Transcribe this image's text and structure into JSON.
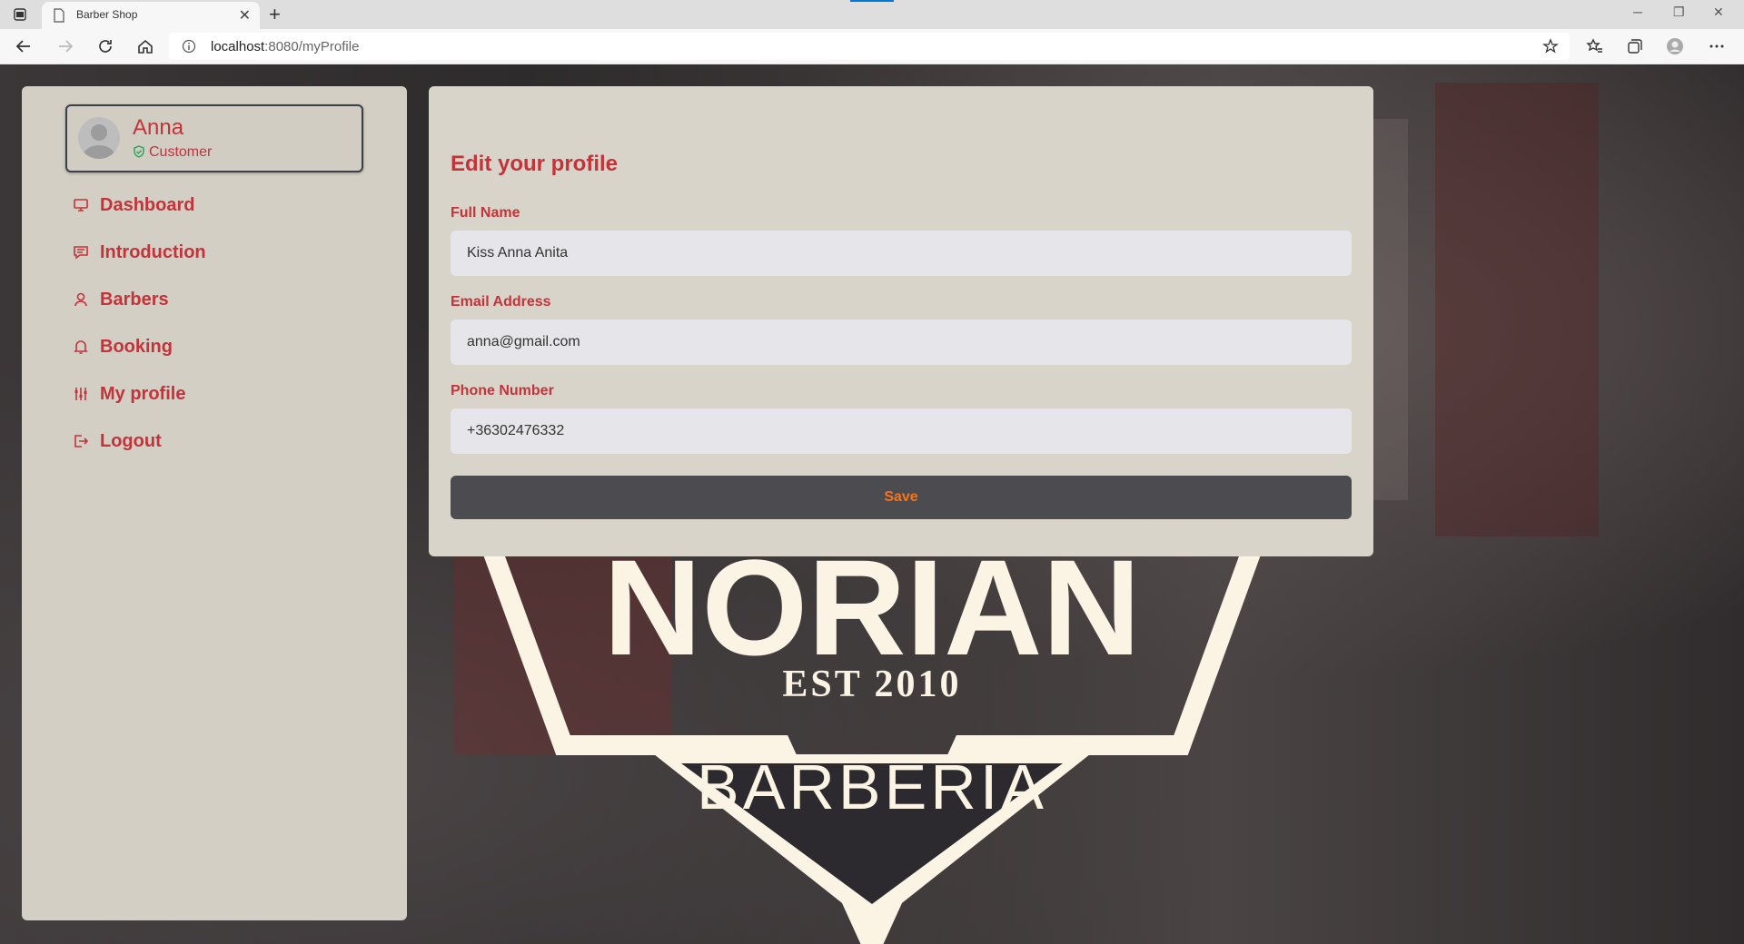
{
  "browser": {
    "tab_title": "Barber Shop",
    "url_host": "localhost",
    "url_path": ":8080/myProfile"
  },
  "logo": {
    "name": "NORIAN",
    "est": "EST 2010",
    "subtitle": "BARBERIA"
  },
  "sidebar": {
    "user_name": "Anna",
    "user_role": "Customer",
    "items": [
      {
        "label": "Dashboard",
        "icon": "monitor-icon"
      },
      {
        "label": "Introduction",
        "icon": "message-icon"
      },
      {
        "label": "Barbers",
        "icon": "user-icon"
      },
      {
        "label": "Booking",
        "icon": "bell-icon"
      },
      {
        "label": "My profile",
        "icon": "sliders-icon"
      },
      {
        "label": "Logout",
        "icon": "logout-icon"
      }
    ]
  },
  "form": {
    "title": "Edit your profile",
    "full_name_label": "Full Name",
    "full_name_value": "Kiss Anna Anita",
    "email_label": "Email Address",
    "email_value": "anna@gmail.com",
    "phone_label": "Phone Number",
    "phone_value": "+36302476332",
    "save_label": "Save"
  },
  "colors": {
    "accent_red": "#c4333a",
    "save_text": "#f97316",
    "panel_bg": "#d8d4c9"
  }
}
